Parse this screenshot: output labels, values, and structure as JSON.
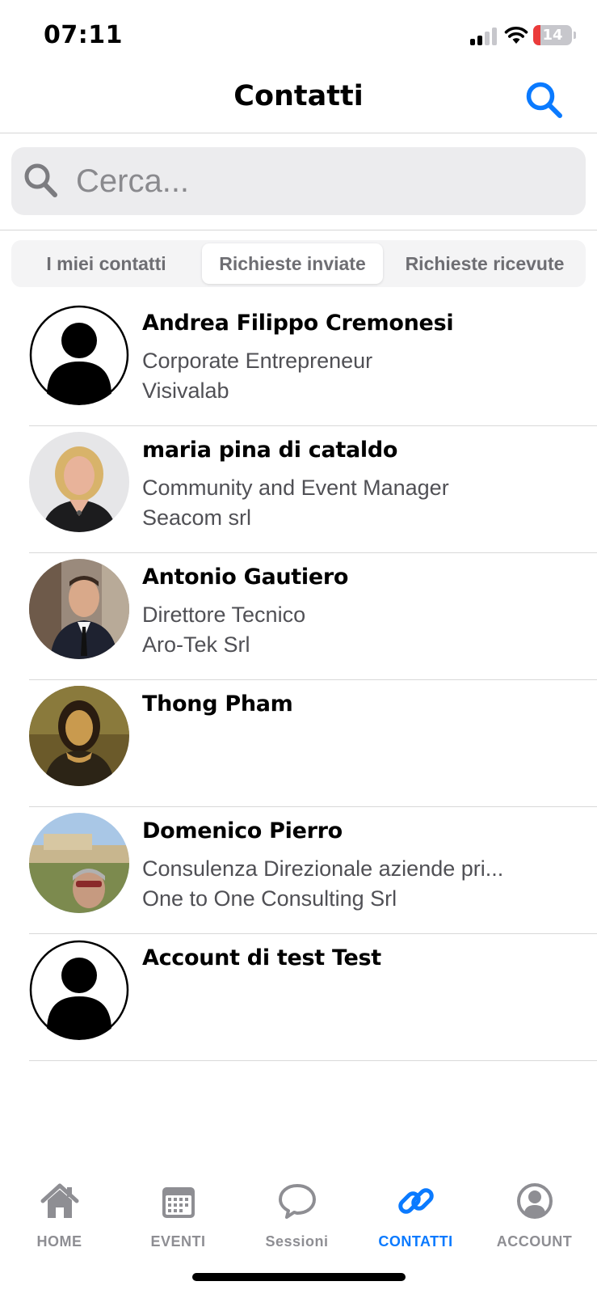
{
  "status_bar": {
    "time": "07:11",
    "battery": "14",
    "battery_color": "#eb3b3b"
  },
  "header": {
    "title": "Contatti",
    "search_icon": "search-icon",
    "accent_color": "#0a7aff"
  },
  "search": {
    "placeholder": "Cerca...",
    "value": ""
  },
  "segments": [
    {
      "label": "I miei contatti",
      "active": false
    },
    {
      "label": "Richieste inviate",
      "active": true
    },
    {
      "label": "Richieste ricevute",
      "active": false
    }
  ],
  "contacts": [
    {
      "name": "Andrea Filippo Cremonesi",
      "role": "Corporate Entrepreneur",
      "company": "Visivalab",
      "avatar": "default-avatar-icon"
    },
    {
      "name": "maria pina di cataldo",
      "role": "Community and Event Manager",
      "company": "Seacom srl",
      "avatar": "photo-woman"
    },
    {
      "name": "Antonio Gautiero",
      "role": "Direttore Tecnico",
      "company": "Aro-Tek Srl",
      "avatar": "photo-man-suit"
    },
    {
      "name": "Thong Pham",
      "role": "",
      "company": "",
      "avatar": "photo-mona-lisa"
    },
    {
      "name": "Domenico Pierro",
      "role": "Consulenza Direzionale aziende pri...",
      "company": "One to One Consulting Srl",
      "avatar": "photo-acropolis"
    },
    {
      "name": "Account di test Test",
      "role": "",
      "company": "",
      "avatar": "default-avatar-icon"
    }
  ],
  "tab_bar": {
    "items": [
      {
        "label": "HOME",
        "icon": "home-icon",
        "active": false
      },
      {
        "label": "EVENTI",
        "icon": "calendar-icon",
        "active": false
      },
      {
        "label": "Sessioni",
        "icon": "chat-bubble-icon",
        "active": false
      },
      {
        "label": "CONTATTI",
        "icon": "link-icon",
        "active": true
      },
      {
        "label": "ACCOUNT",
        "icon": "account-circle-icon",
        "active": false
      }
    ]
  }
}
